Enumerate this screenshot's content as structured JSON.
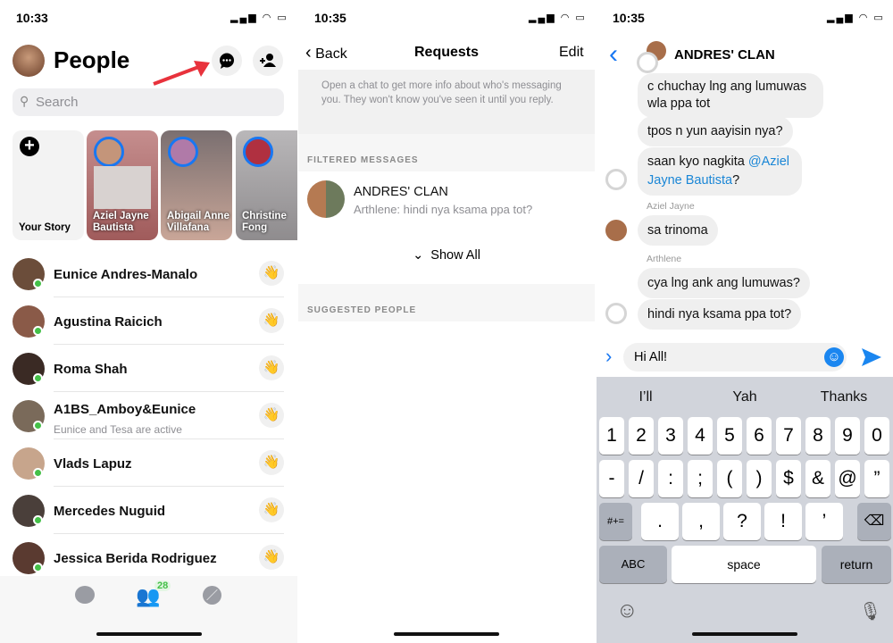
{
  "people": {
    "time": "10:33",
    "title": "People",
    "search_placeholder": "Search",
    "stories": [
      {
        "label": "Your Story"
      },
      {
        "label": "Aziel Jayne Bautista"
      },
      {
        "label": "Abigail Anne Villafana"
      },
      {
        "label": "Christine Fong"
      }
    ],
    "contacts": [
      {
        "name": "Eunice Andres-Manalo"
      },
      {
        "name": "Agustina Raicich"
      },
      {
        "name": "Roma Shah"
      },
      {
        "name": "A1BS_Amboy&Eunice",
        "sub": "Eunice and Tesa are active"
      },
      {
        "name": "Vlads Lapuz"
      },
      {
        "name": "Mercedes Nuguid"
      },
      {
        "name": "Jessica Berida Rodriguez"
      }
    ],
    "tabs": {
      "people_badge": "28"
    },
    "accent": "#1877f2",
    "online": "#44c048",
    "arrow": "#e8323c"
  },
  "requests": {
    "time": "10:35",
    "back": "Back",
    "title": "Requests",
    "edit": "Edit",
    "info": "Open a chat to get more info about who's messaging you. They won't know you've seen it until you reply.",
    "filtered_header": "FILTERED MESSAGES",
    "thread": {
      "name": "ANDRES' CLAN",
      "preview": "Arthlene: hindi nya ksama ppa tot?"
    },
    "show_all": "Show All",
    "suggested_header": "SUGGESTED PEOPLE"
  },
  "chat": {
    "time": "10:35",
    "title": "ANDRES' CLAN",
    "m1": "c chuchay lng ang lumuwas wla ppa tot",
    "m2": "tpos n yun aayisin nya?",
    "m3a": "saan kyo nagkita ",
    "m3mention": "@Aziel Jayne Bautista",
    "m3b": "?",
    "sender1": "Aziel Jayne",
    "m4": "sa trinoma",
    "sender2": "Arthlene",
    "m5": "cya lng ank ang lumuwas?",
    "m6": "hindi nya ksama ppa tot?",
    "input": "Hi All!",
    "suggestions": [
      "I’ll",
      "Yah",
      "Thanks"
    ],
    "row1": [
      "1",
      "2",
      "3",
      "4",
      "5",
      "6",
      "7",
      "8",
      "9",
      "0"
    ],
    "row2": [
      "-",
      "/",
      ":",
      ";",
      "(",
      ")",
      "$",
      "&",
      "@",
      "”"
    ],
    "row3_mode": "#+=",
    "row3": [
      ".",
      ",",
      "?",
      "!",
      "’"
    ],
    "abc": "ABC",
    "space": "space",
    "return": "return"
  }
}
